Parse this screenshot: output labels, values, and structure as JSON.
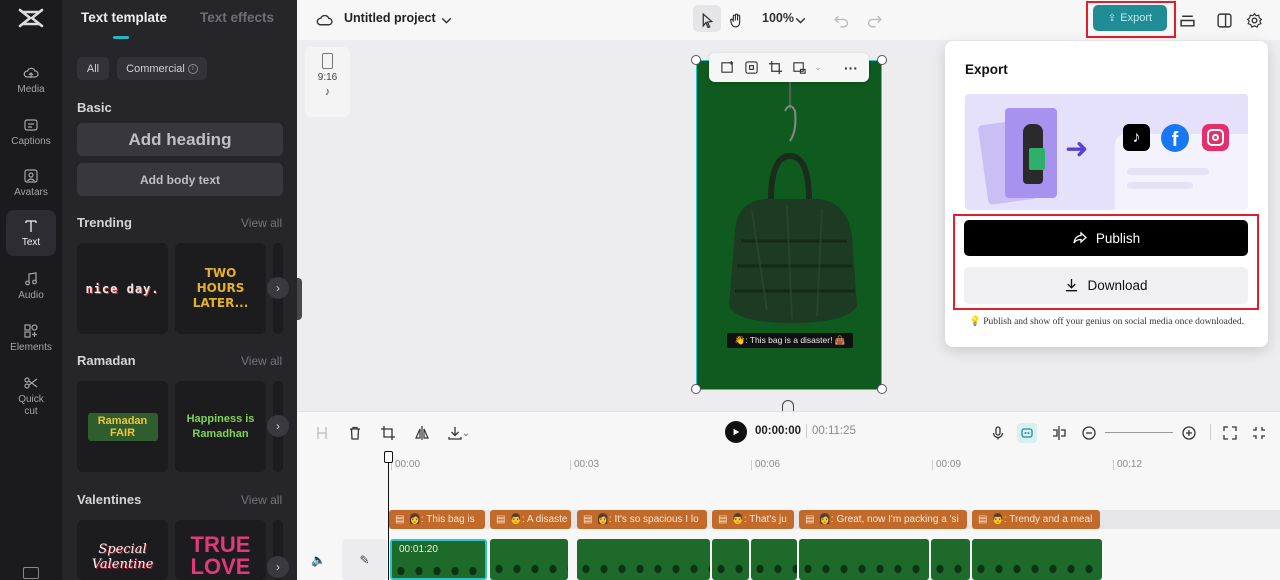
{
  "left_nav": {
    "items": [
      {
        "label": "Media",
        "icon": "cloud-upload-icon"
      },
      {
        "label": "Captions",
        "icon": "captions-icon"
      },
      {
        "label": "Avatars",
        "icon": "avatar-icon"
      },
      {
        "label": "Text",
        "icon": "text-icon"
      },
      {
        "label": "Audio",
        "icon": "music-icon"
      },
      {
        "label": "Elements",
        "icon": "elements-icon"
      },
      {
        "label": "Quick\ncut",
        "icon": "quick-cut-icon"
      }
    ],
    "active": "Text"
  },
  "panel": {
    "tabs": [
      "Text template",
      "Text effects"
    ],
    "filters": {
      "all": "All",
      "commercial": "Commercial"
    },
    "basic": {
      "title": "Basic",
      "add_heading": "Add heading",
      "add_body": "Add body text"
    },
    "sections": [
      {
        "title": "Trending",
        "view_all": "View all",
        "cards": [
          "nice day.",
          "TWO HOURS LATER..."
        ]
      },
      {
        "title": "Ramadan",
        "view_all": "View all",
        "cards": [
          "Ramadan FAIR",
          "Happiness is Ramadhan"
        ]
      },
      {
        "title": "Valentines",
        "view_all": "View all",
        "cards": [
          "Special Valentine",
          "TRUE LOVE"
        ]
      }
    ]
  },
  "topbar": {
    "project_name": "Untitled project",
    "zoom": "100%",
    "export_label": "Export"
  },
  "canvas": {
    "ratio": "9:16",
    "platform_icon": "tiktok-icon",
    "caption": "👋: This bag is a disaster! 👜"
  },
  "playback": {
    "current_time": "00:00:00",
    "total_time": "00:11:25"
  },
  "timeline": {
    "ticks": [
      "00:00",
      "00:03",
      "00:06",
      "00:09",
      "00:12"
    ],
    "clip_duration": "00:01:20",
    "subtitles": [
      "👩: This bag is",
      "👨: A disaste",
      "👩: It's so spacious I lo",
      "👨: That's ju",
      "👩: Great, now I'm packing a 'si",
      "👨: Trendy and a meal"
    ]
  },
  "export_popup": {
    "title": "Export",
    "publish_label": "Publish",
    "download_label": "Download",
    "hint": "💡 Publish and show off your genius on social media once downloaded.",
    "social_icons": [
      "tiktok-icon",
      "facebook-icon",
      "instagram-icon"
    ]
  },
  "colors": {
    "accent": "#1f8c96",
    "highlight": "#e21e2d",
    "canvas_bg": "#0f5a1f",
    "subtitle_clip": "#c26a2a"
  }
}
